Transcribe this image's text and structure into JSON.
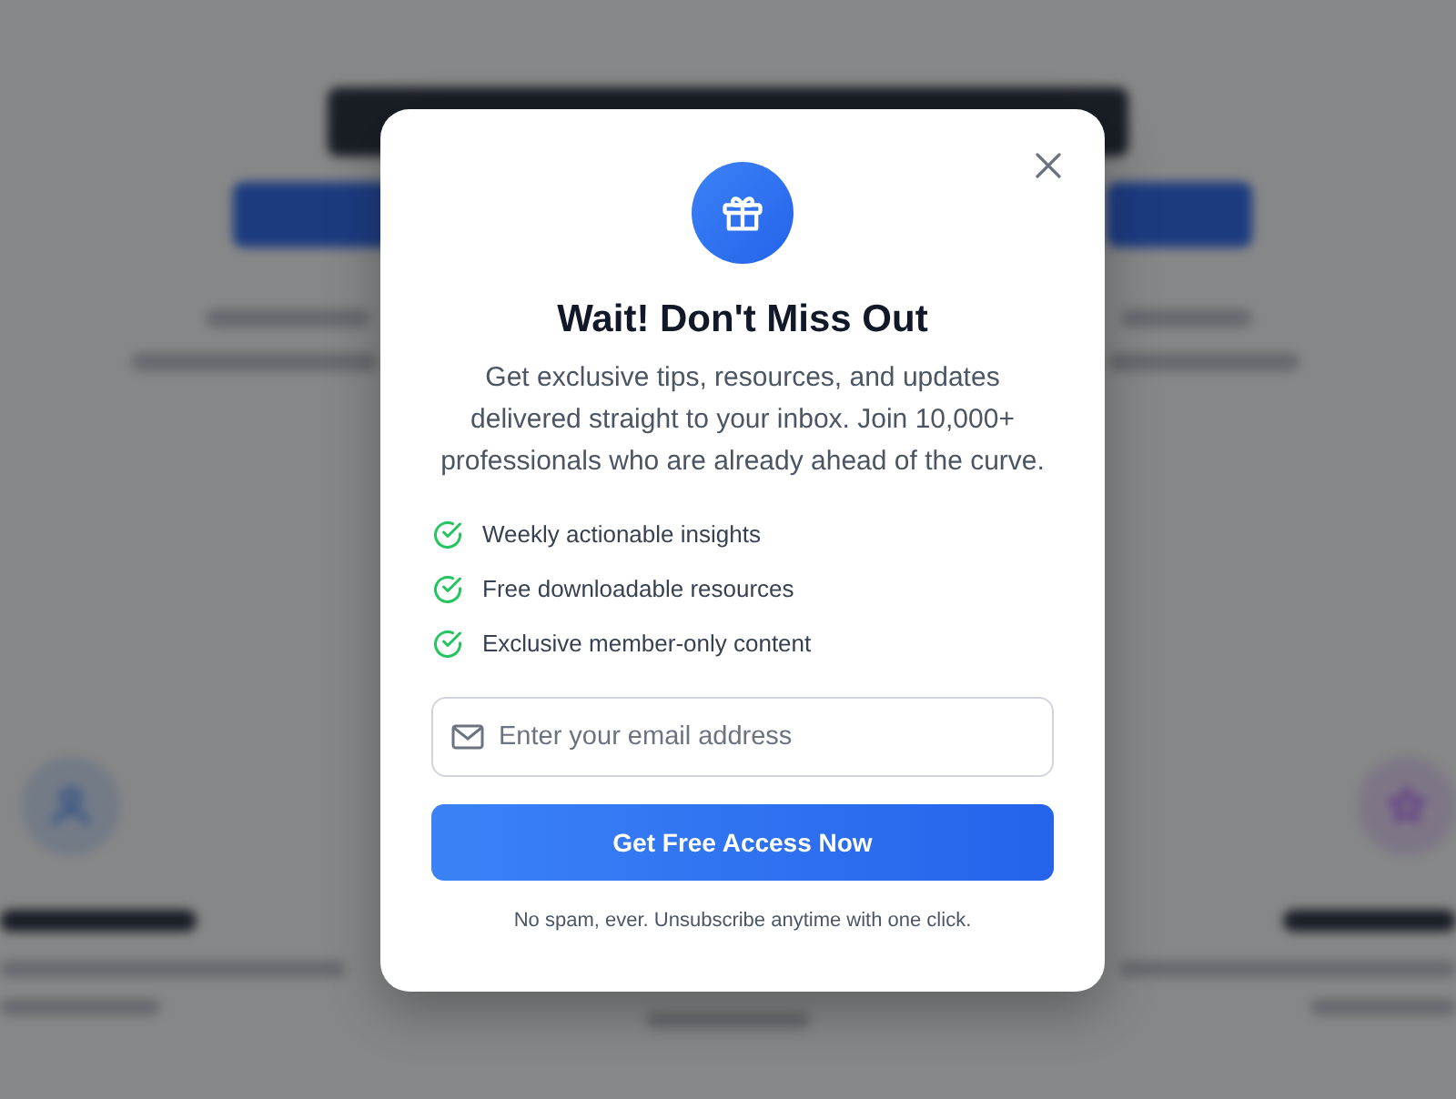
{
  "modal": {
    "title": "Wait! Don't Miss Out",
    "description": "Get exclusive tips, resources, and updates delivered straight to your inbox. Join 10,000+ professionals who are already ahead of the curve.",
    "benefits": [
      {
        "label": "Weekly actionable insights",
        "checked": true
      },
      {
        "label": "Free downloadable resources",
        "checked": true
      },
      {
        "label": "Exclusive member-only content",
        "checked": true
      }
    ],
    "email_field": {
      "placeholder": "Enter your email address"
    },
    "submit_button": "Get Free Access Now",
    "footnote": "No spam, ever. Unsubscribe anytime with one click."
  }
}
